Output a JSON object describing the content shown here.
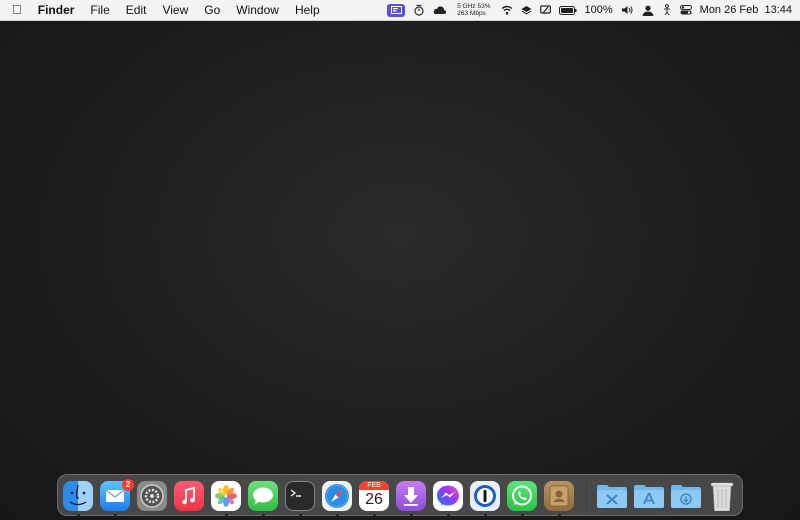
{
  "menubar": {
    "app_name": "Finder",
    "menus": [
      "File",
      "Edit",
      "View",
      "Go",
      "Window",
      "Help"
    ],
    "status": {
      "network_line1": "5 GHz 53%",
      "network_line2": "263 Mbps",
      "battery_label": "100%",
      "clock": "Mon 26 Feb  13:44"
    }
  },
  "dock": {
    "apps": [
      {
        "name": "Finder",
        "icon": "finder-icon",
        "running": true
      },
      {
        "name": "Mail",
        "icon": "mail-icon",
        "running": true,
        "badge": "2"
      },
      {
        "name": "System Settings",
        "icon": "system-settings-icon",
        "running": false
      },
      {
        "name": "Music",
        "icon": "music-icon",
        "running": false
      },
      {
        "name": "Photos",
        "icon": "photos-icon",
        "running": true
      },
      {
        "name": "Messages",
        "icon": "messages-icon",
        "running": true
      },
      {
        "name": "Terminal",
        "icon": "terminal-icon",
        "running": true
      },
      {
        "name": "Safari",
        "icon": "safari-icon",
        "running": true
      },
      {
        "name": "Calendar",
        "icon": "calendar-icon",
        "running": true,
        "month": "FEB",
        "day": "26"
      },
      {
        "name": "Downloader",
        "icon": "downloader-icon",
        "running": true
      },
      {
        "name": "Messenger",
        "icon": "messenger-icon",
        "running": true
      },
      {
        "name": "1Password",
        "icon": "onepassword-icon",
        "running": true
      },
      {
        "name": "WhatsApp",
        "icon": "whatsapp-icon",
        "running": true
      },
      {
        "name": "Contacts",
        "icon": "contacts-icon",
        "running": true
      }
    ],
    "folders": [
      "utilities-folder-icon",
      "applications-folder-icon",
      "downloads-folder-icon"
    ],
    "trash": "trash-icon",
    "colors": {
      "folder": "#6fb8ee",
      "badge": "#ff3b30",
      "accent": "#5b50d6"
    }
  }
}
